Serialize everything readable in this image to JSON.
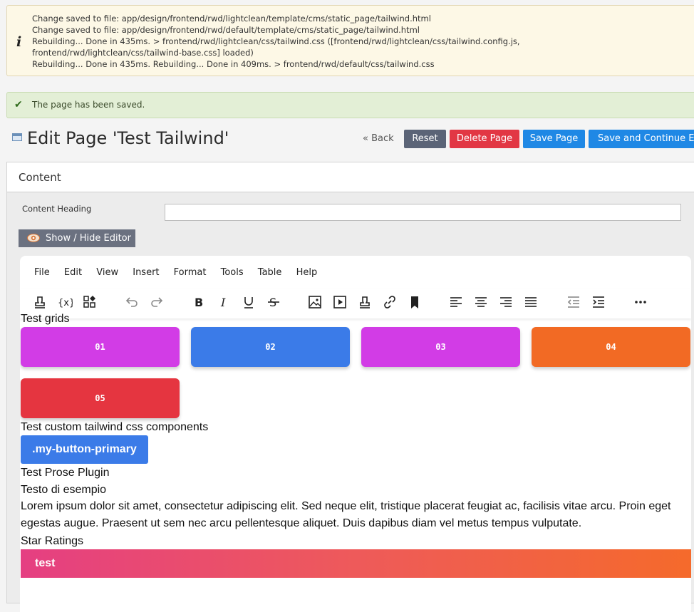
{
  "messages": {
    "info_lines": [
      "Change saved to file: app/design/frontend/rwd/lightclean/template/cms/static_page/tailwind.html",
      "Change saved to file: app/design/frontend/rwd/default/template/cms/static_page/tailwind.html",
      "Rebuilding... Done in 435ms. > frontend/rwd/lightclean/css/tailwind.css ([frontend/rwd/lightclean/css/tailwind.config.js, frontend/rwd/lightclean/css/tailwind-base.css] loaded)",
      "Rebuilding... Done in 435ms. Rebuilding... Done in 409ms. > frontend/rwd/default/css/tailwind.css"
    ],
    "info_icon": "i",
    "success": "The page has been saved.",
    "success_icon": "✔"
  },
  "header": {
    "title": "Edit Page 'Test Tailwind'",
    "back": "« Back",
    "reset": "Reset",
    "delete": "Delete Page",
    "save": "Save Page",
    "save_continue": "Save and Continue Edit"
  },
  "content": {
    "tab_label": "Content",
    "heading_label": "Content Heading",
    "heading_value": "",
    "toggle_editor": "Show / Hide Editor"
  },
  "editor": {
    "menu": [
      "File",
      "Edit",
      "View",
      "Insert",
      "Format",
      "Tools",
      "Table",
      "Help"
    ],
    "toolbar_icons": [
      "stamp-icon",
      "variable-icon",
      "widget-icon",
      "undo-icon",
      "redo-icon",
      "bold-icon",
      "italic-icon",
      "underline-icon",
      "strikethrough-icon",
      "image-icon",
      "media-icon",
      "stamp-icon",
      "link-icon",
      "bookmark-icon",
      "align-left-icon",
      "align-center-icon",
      "align-right-icon",
      "justify-icon",
      "outdent-icon",
      "indent-icon",
      "more-icon"
    ],
    "body": {
      "grids_title": "Test grids",
      "grids": [
        {
          "label": "01",
          "color": "#d23ce6"
        },
        {
          "label": "02",
          "color": "#3b7be8"
        },
        {
          "label": "03",
          "color": "#d23ce6"
        },
        {
          "label": "04",
          "color": "#f26a24"
        },
        {
          "label": "05",
          "color": "#e53540"
        }
      ],
      "components_title": "Test custom tailwind css components",
      "button_label": ".my-button-primary",
      "prose_title": "Test Prose Plugin",
      "prose_heading": "Testo di esempio",
      "prose_paragraph": "Lorem ipsum dolor sit amet, consectetur adipiscing elit. Sed neque elit, tristique placerat feugiat ac, facilisis vitae arcu. Proin eget egestas augue. Praesent ut sem nec arcu pellentesque aliquet. Duis dapibus diam vel metus tempus vulputate.",
      "ratings_title": "Star Ratings",
      "rating_bar_label": "test"
    }
  }
}
